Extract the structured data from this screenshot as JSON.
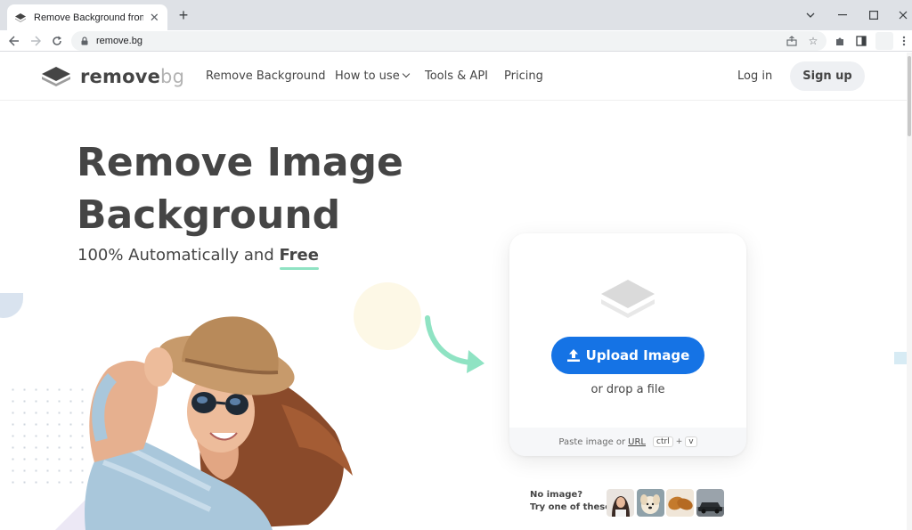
{
  "browser": {
    "tab_title": "Remove Background from Image",
    "new_tab": "+",
    "url": "remove.bg",
    "window_controls": [
      "chevron-down-icon",
      "minimize-icon",
      "maximize-icon",
      "close-icon"
    ]
  },
  "header": {
    "logo_main": "remove",
    "logo_light": "bg",
    "nav": [
      {
        "label": "Remove Background"
      },
      {
        "label": "How to use"
      },
      {
        "label": "Tools & API"
      },
      {
        "label": "Pricing"
      }
    ],
    "login_label": "Log in",
    "signup_label": "Sign up"
  },
  "hero": {
    "title_line1": "Remove Image",
    "title_line2": "Background",
    "subtitle": "100% Automatically and",
    "subtitle_emphasis": "Free"
  },
  "upload": {
    "button_label": "Upload Image",
    "drop_text": "or drop a file",
    "paste_text": "Paste image or",
    "url_link": "URL",
    "key_ctrl": "ctrl",
    "key_plus": "+",
    "key_v": "v"
  },
  "samples": {
    "line1": "No image?",
    "line2": "Try one of these:"
  },
  "colors": {
    "primary_blue": "#1573e5",
    "accent_green": "#8fe3c3",
    "text_dark": "#454545"
  }
}
